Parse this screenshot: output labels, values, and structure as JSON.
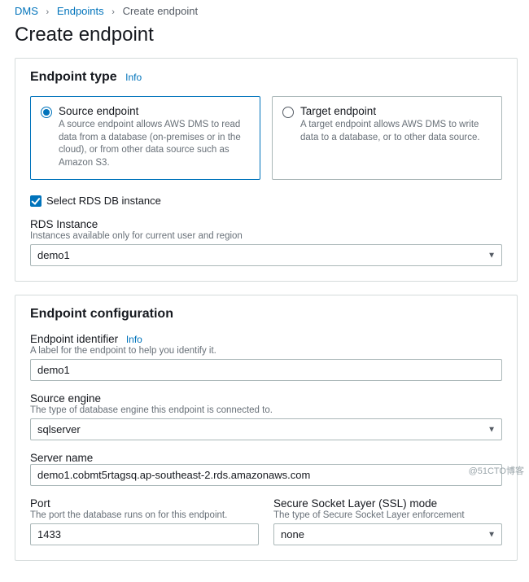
{
  "breadcrumb": {
    "l1": "DMS",
    "l2": "Endpoints",
    "current": "Create endpoint"
  },
  "page_title": "Create endpoint",
  "endpoint_type": {
    "heading": "Endpoint type",
    "info": "Info",
    "source": {
      "title": "Source endpoint",
      "desc": "A source endpoint allows AWS DMS to read data from a database (on-premises or in the cloud), or from other data source such as Amazon S3."
    },
    "target": {
      "title": "Target endpoint",
      "desc": "A target endpoint allows AWS DMS to write data to a database, or to other data source."
    },
    "checkbox_label": "Select RDS DB instance",
    "rds_label": "RDS Instance",
    "rds_hint": "Instances available only for current user and region",
    "rds_value": "demo1"
  },
  "config": {
    "heading": "Endpoint configuration",
    "identifier_label": "Endpoint identifier",
    "identifier_info": "Info",
    "identifier_hint": "A label for the endpoint to help you identify it.",
    "identifier_value": "demo1",
    "engine_label": "Source engine",
    "engine_hint": "The type of database engine this endpoint is connected to.",
    "engine_value": "sqlserver",
    "server_label": "Server name",
    "server_value": "demo1.cobmt5rtagsq.ap-southeast-2.rds.amazonaws.com",
    "port_label": "Port",
    "port_hint": "The port the database runs on for this endpoint.",
    "port_value": "1433",
    "ssl_label": "Secure Socket Layer (SSL) mode",
    "ssl_hint": "The type of Secure Socket Layer enforcement",
    "ssl_value": "none"
  },
  "watermark": "@51CTO博客"
}
